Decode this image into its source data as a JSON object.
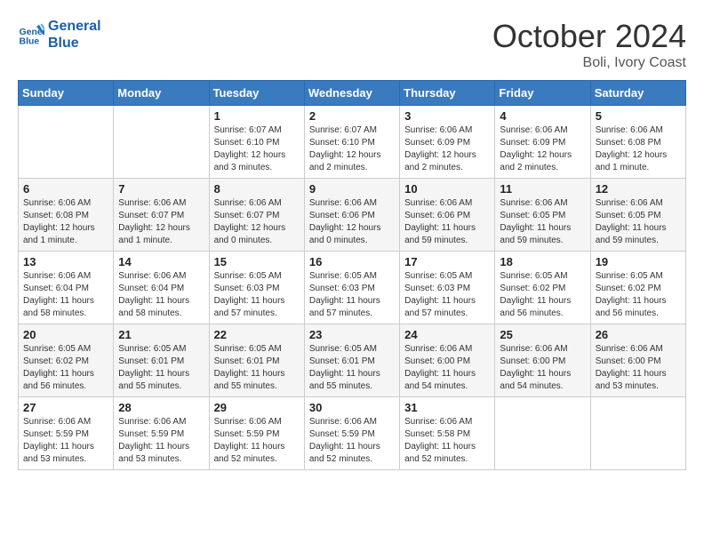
{
  "header": {
    "logo_line1": "General",
    "logo_line2": "Blue",
    "month": "October 2024",
    "location": "Boli, Ivory Coast"
  },
  "weekdays": [
    "Sunday",
    "Monday",
    "Tuesday",
    "Wednesday",
    "Thursday",
    "Friday",
    "Saturday"
  ],
  "weeks": [
    [
      {
        "day": "",
        "info": ""
      },
      {
        "day": "",
        "info": ""
      },
      {
        "day": "1",
        "info": "Sunrise: 6:07 AM\nSunset: 6:10 PM\nDaylight: 12 hours and 3 minutes."
      },
      {
        "day": "2",
        "info": "Sunrise: 6:07 AM\nSunset: 6:10 PM\nDaylight: 12 hours and 2 minutes."
      },
      {
        "day": "3",
        "info": "Sunrise: 6:06 AM\nSunset: 6:09 PM\nDaylight: 12 hours and 2 minutes."
      },
      {
        "day": "4",
        "info": "Sunrise: 6:06 AM\nSunset: 6:09 PM\nDaylight: 12 hours and 2 minutes."
      },
      {
        "day": "5",
        "info": "Sunrise: 6:06 AM\nSunset: 6:08 PM\nDaylight: 12 hours and 1 minute."
      }
    ],
    [
      {
        "day": "6",
        "info": "Sunrise: 6:06 AM\nSunset: 6:08 PM\nDaylight: 12 hours and 1 minute."
      },
      {
        "day": "7",
        "info": "Sunrise: 6:06 AM\nSunset: 6:07 PM\nDaylight: 12 hours and 1 minute."
      },
      {
        "day": "8",
        "info": "Sunrise: 6:06 AM\nSunset: 6:07 PM\nDaylight: 12 hours and 0 minutes."
      },
      {
        "day": "9",
        "info": "Sunrise: 6:06 AM\nSunset: 6:06 PM\nDaylight: 12 hours and 0 minutes."
      },
      {
        "day": "10",
        "info": "Sunrise: 6:06 AM\nSunset: 6:06 PM\nDaylight: 11 hours and 59 minutes."
      },
      {
        "day": "11",
        "info": "Sunrise: 6:06 AM\nSunset: 6:05 PM\nDaylight: 11 hours and 59 minutes."
      },
      {
        "day": "12",
        "info": "Sunrise: 6:06 AM\nSunset: 6:05 PM\nDaylight: 11 hours and 59 minutes."
      }
    ],
    [
      {
        "day": "13",
        "info": "Sunrise: 6:06 AM\nSunset: 6:04 PM\nDaylight: 11 hours and 58 minutes."
      },
      {
        "day": "14",
        "info": "Sunrise: 6:06 AM\nSunset: 6:04 PM\nDaylight: 11 hours and 58 minutes."
      },
      {
        "day": "15",
        "info": "Sunrise: 6:05 AM\nSunset: 6:03 PM\nDaylight: 11 hours and 57 minutes."
      },
      {
        "day": "16",
        "info": "Sunrise: 6:05 AM\nSunset: 6:03 PM\nDaylight: 11 hours and 57 minutes."
      },
      {
        "day": "17",
        "info": "Sunrise: 6:05 AM\nSunset: 6:03 PM\nDaylight: 11 hours and 57 minutes."
      },
      {
        "day": "18",
        "info": "Sunrise: 6:05 AM\nSunset: 6:02 PM\nDaylight: 11 hours and 56 minutes."
      },
      {
        "day": "19",
        "info": "Sunrise: 6:05 AM\nSunset: 6:02 PM\nDaylight: 11 hours and 56 minutes."
      }
    ],
    [
      {
        "day": "20",
        "info": "Sunrise: 6:05 AM\nSunset: 6:02 PM\nDaylight: 11 hours and 56 minutes."
      },
      {
        "day": "21",
        "info": "Sunrise: 6:05 AM\nSunset: 6:01 PM\nDaylight: 11 hours and 55 minutes."
      },
      {
        "day": "22",
        "info": "Sunrise: 6:05 AM\nSunset: 6:01 PM\nDaylight: 11 hours and 55 minutes."
      },
      {
        "day": "23",
        "info": "Sunrise: 6:05 AM\nSunset: 6:01 PM\nDaylight: 11 hours and 55 minutes."
      },
      {
        "day": "24",
        "info": "Sunrise: 6:06 AM\nSunset: 6:00 PM\nDaylight: 11 hours and 54 minutes."
      },
      {
        "day": "25",
        "info": "Sunrise: 6:06 AM\nSunset: 6:00 PM\nDaylight: 11 hours and 54 minutes."
      },
      {
        "day": "26",
        "info": "Sunrise: 6:06 AM\nSunset: 6:00 PM\nDaylight: 11 hours and 53 minutes."
      }
    ],
    [
      {
        "day": "27",
        "info": "Sunrise: 6:06 AM\nSunset: 5:59 PM\nDaylight: 11 hours and 53 minutes."
      },
      {
        "day": "28",
        "info": "Sunrise: 6:06 AM\nSunset: 5:59 PM\nDaylight: 11 hours and 53 minutes."
      },
      {
        "day": "29",
        "info": "Sunrise: 6:06 AM\nSunset: 5:59 PM\nDaylight: 11 hours and 52 minutes."
      },
      {
        "day": "30",
        "info": "Sunrise: 6:06 AM\nSunset: 5:59 PM\nDaylight: 11 hours and 52 minutes."
      },
      {
        "day": "31",
        "info": "Sunrise: 6:06 AM\nSunset: 5:58 PM\nDaylight: 11 hours and 52 minutes."
      },
      {
        "day": "",
        "info": ""
      },
      {
        "day": "",
        "info": ""
      }
    ]
  ]
}
